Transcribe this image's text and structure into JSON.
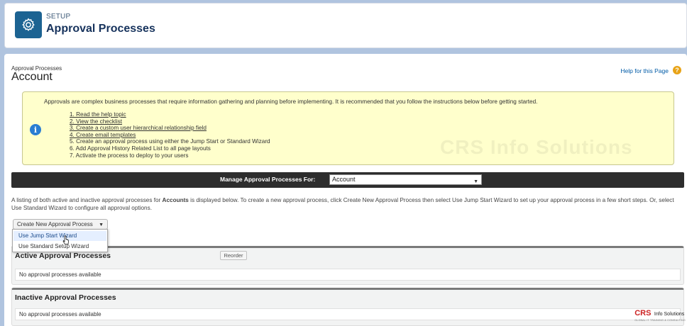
{
  "header": {
    "section_label": "SETUP",
    "title": "Approval Processes",
    "icon": "gear-icon"
  },
  "page": {
    "breadcrumb": "Approval Processes",
    "title": "Account",
    "help_link": "Help for this Page",
    "help_icon": "question-icon"
  },
  "info_box": {
    "icon": "info-icon",
    "intro": "Approvals are complex business processes that require information gathering and planning before implementing. It is recommended that you follow the instructions below before getting started.",
    "steps": [
      "1. Read the help topic",
      "2. View the checklist",
      "3. Create a custom user hierarchical relationship field",
      "4. Create email templates",
      "5. Create an approval process using either the Jump Start or Standard Wizard",
      "6. Add Approval History Related List to all page layouts",
      "7. Activate the process to deploy to your users"
    ],
    "watermark": "CRS Info Solutions"
  },
  "manage_bar": {
    "label": "Manage Approval Processes For:",
    "selected": "Account"
  },
  "listing": {
    "text_before": "A listing of both active and inactive approval processes for ",
    "object": "Accounts",
    "text_after": " is displayed below. To create a new approval process, click Create New Approval Process then select Use Jump Start Wizard to set up your approval process in a few short steps. Or, select Use Standard Wizard to configure all approval options."
  },
  "create_button": {
    "label": "Create New Approval Process",
    "options": [
      "Use Jump Start Wizard",
      "Use Standard Setup Wizard"
    ]
  },
  "sections": {
    "active": {
      "title": "Active Approval Processes",
      "reorder": "Reorder",
      "empty": "No approval processes available"
    },
    "inactive": {
      "title": "Inactive Approval Processes",
      "empty": "No approval processes available"
    }
  },
  "logo": {
    "brand": "CRS",
    "name": "Info Solutions",
    "tagline": "GLOBAL IT TRAINING & CONSULTING"
  },
  "colors": {
    "header_icon_bg": "#1c6392",
    "info_bg": "#ffffcc",
    "manage_bar_bg": "#2d2d2d",
    "link": "#015ba7"
  }
}
